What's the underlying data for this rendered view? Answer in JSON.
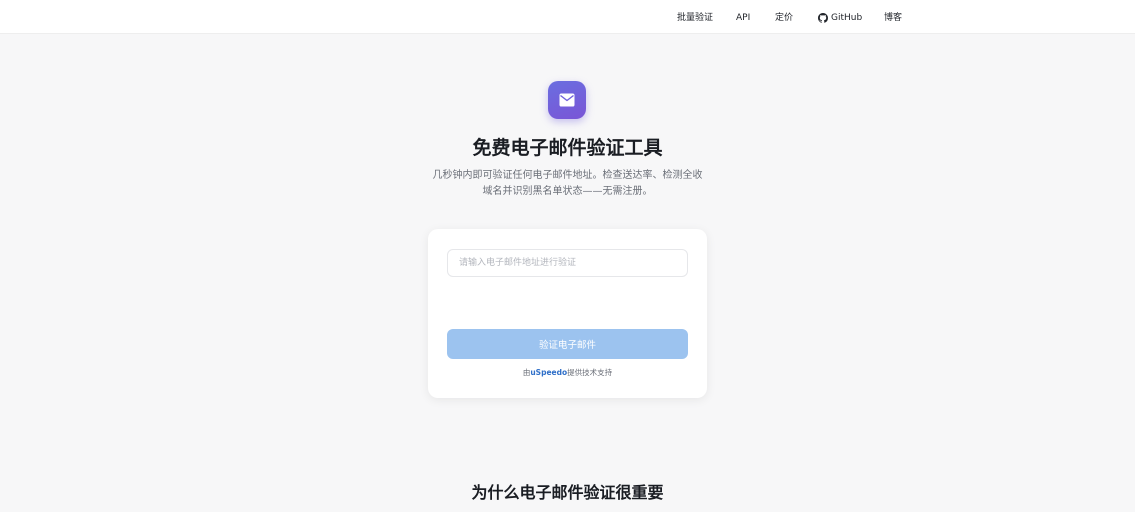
{
  "nav": {
    "batch": "批量验证",
    "api": "API",
    "pricing": "定价",
    "github": "GitHub",
    "blog": "博客"
  },
  "hero": {
    "icon": "mail-icon",
    "title": "免费电子邮件验证工具",
    "subtitle": "几秒钟内即可验证任何电子邮件地址。检查送达率、检测全收域名并识别黑名单状态——无需注册。"
  },
  "form": {
    "placeholder": "请输入电子邮件地址进行验证",
    "value": "",
    "button_label": "验证电子邮件",
    "powered_prefix": "由",
    "powered_brand": "uSpeedo",
    "powered_suffix": "提供技术支持"
  },
  "section": {
    "title": "为什么电子邮件验证很重要"
  },
  "colors": {
    "accent": "#7a55d6",
    "button_disabled": "#9cc3ef",
    "link": "#2f6fc8"
  }
}
